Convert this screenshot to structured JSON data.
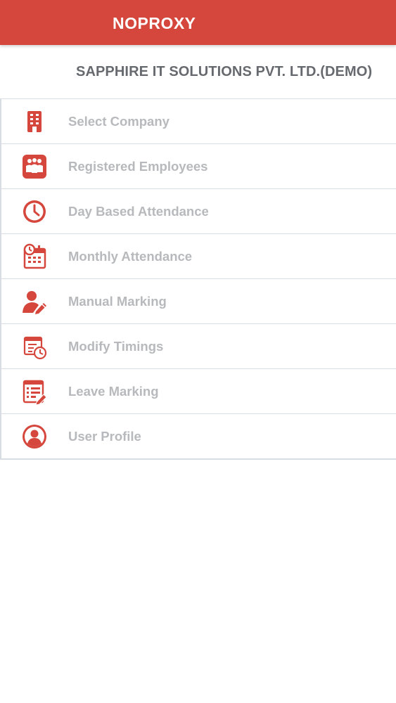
{
  "header": {
    "title": "NOPROXY"
  },
  "company": {
    "name": "SAPPHIRE IT SOLUTIONS PVT. LTD.(DEMO)"
  },
  "menu": {
    "items": [
      {
        "label": "Select Company",
        "icon": "building-icon"
      },
      {
        "label": "Registered Employees",
        "icon": "employees-icon"
      },
      {
        "label": "Day Based Attendance",
        "icon": "clock-icon"
      },
      {
        "label": "Monthly Attendance",
        "icon": "calendar-clock-icon"
      },
      {
        "label": "Manual Marking",
        "icon": "user-edit-icon"
      },
      {
        "label": "Modify Timings",
        "icon": "schedule-edit-icon"
      },
      {
        "label": "Leave Marking",
        "icon": "list-edit-icon"
      },
      {
        "label": "User Profile",
        "icon": "user-profile-icon"
      }
    ]
  },
  "colors": {
    "accent": "#d5473c",
    "icon": "#d5473c",
    "label": "#b7b9bc",
    "company_text": "#666a6e"
  }
}
